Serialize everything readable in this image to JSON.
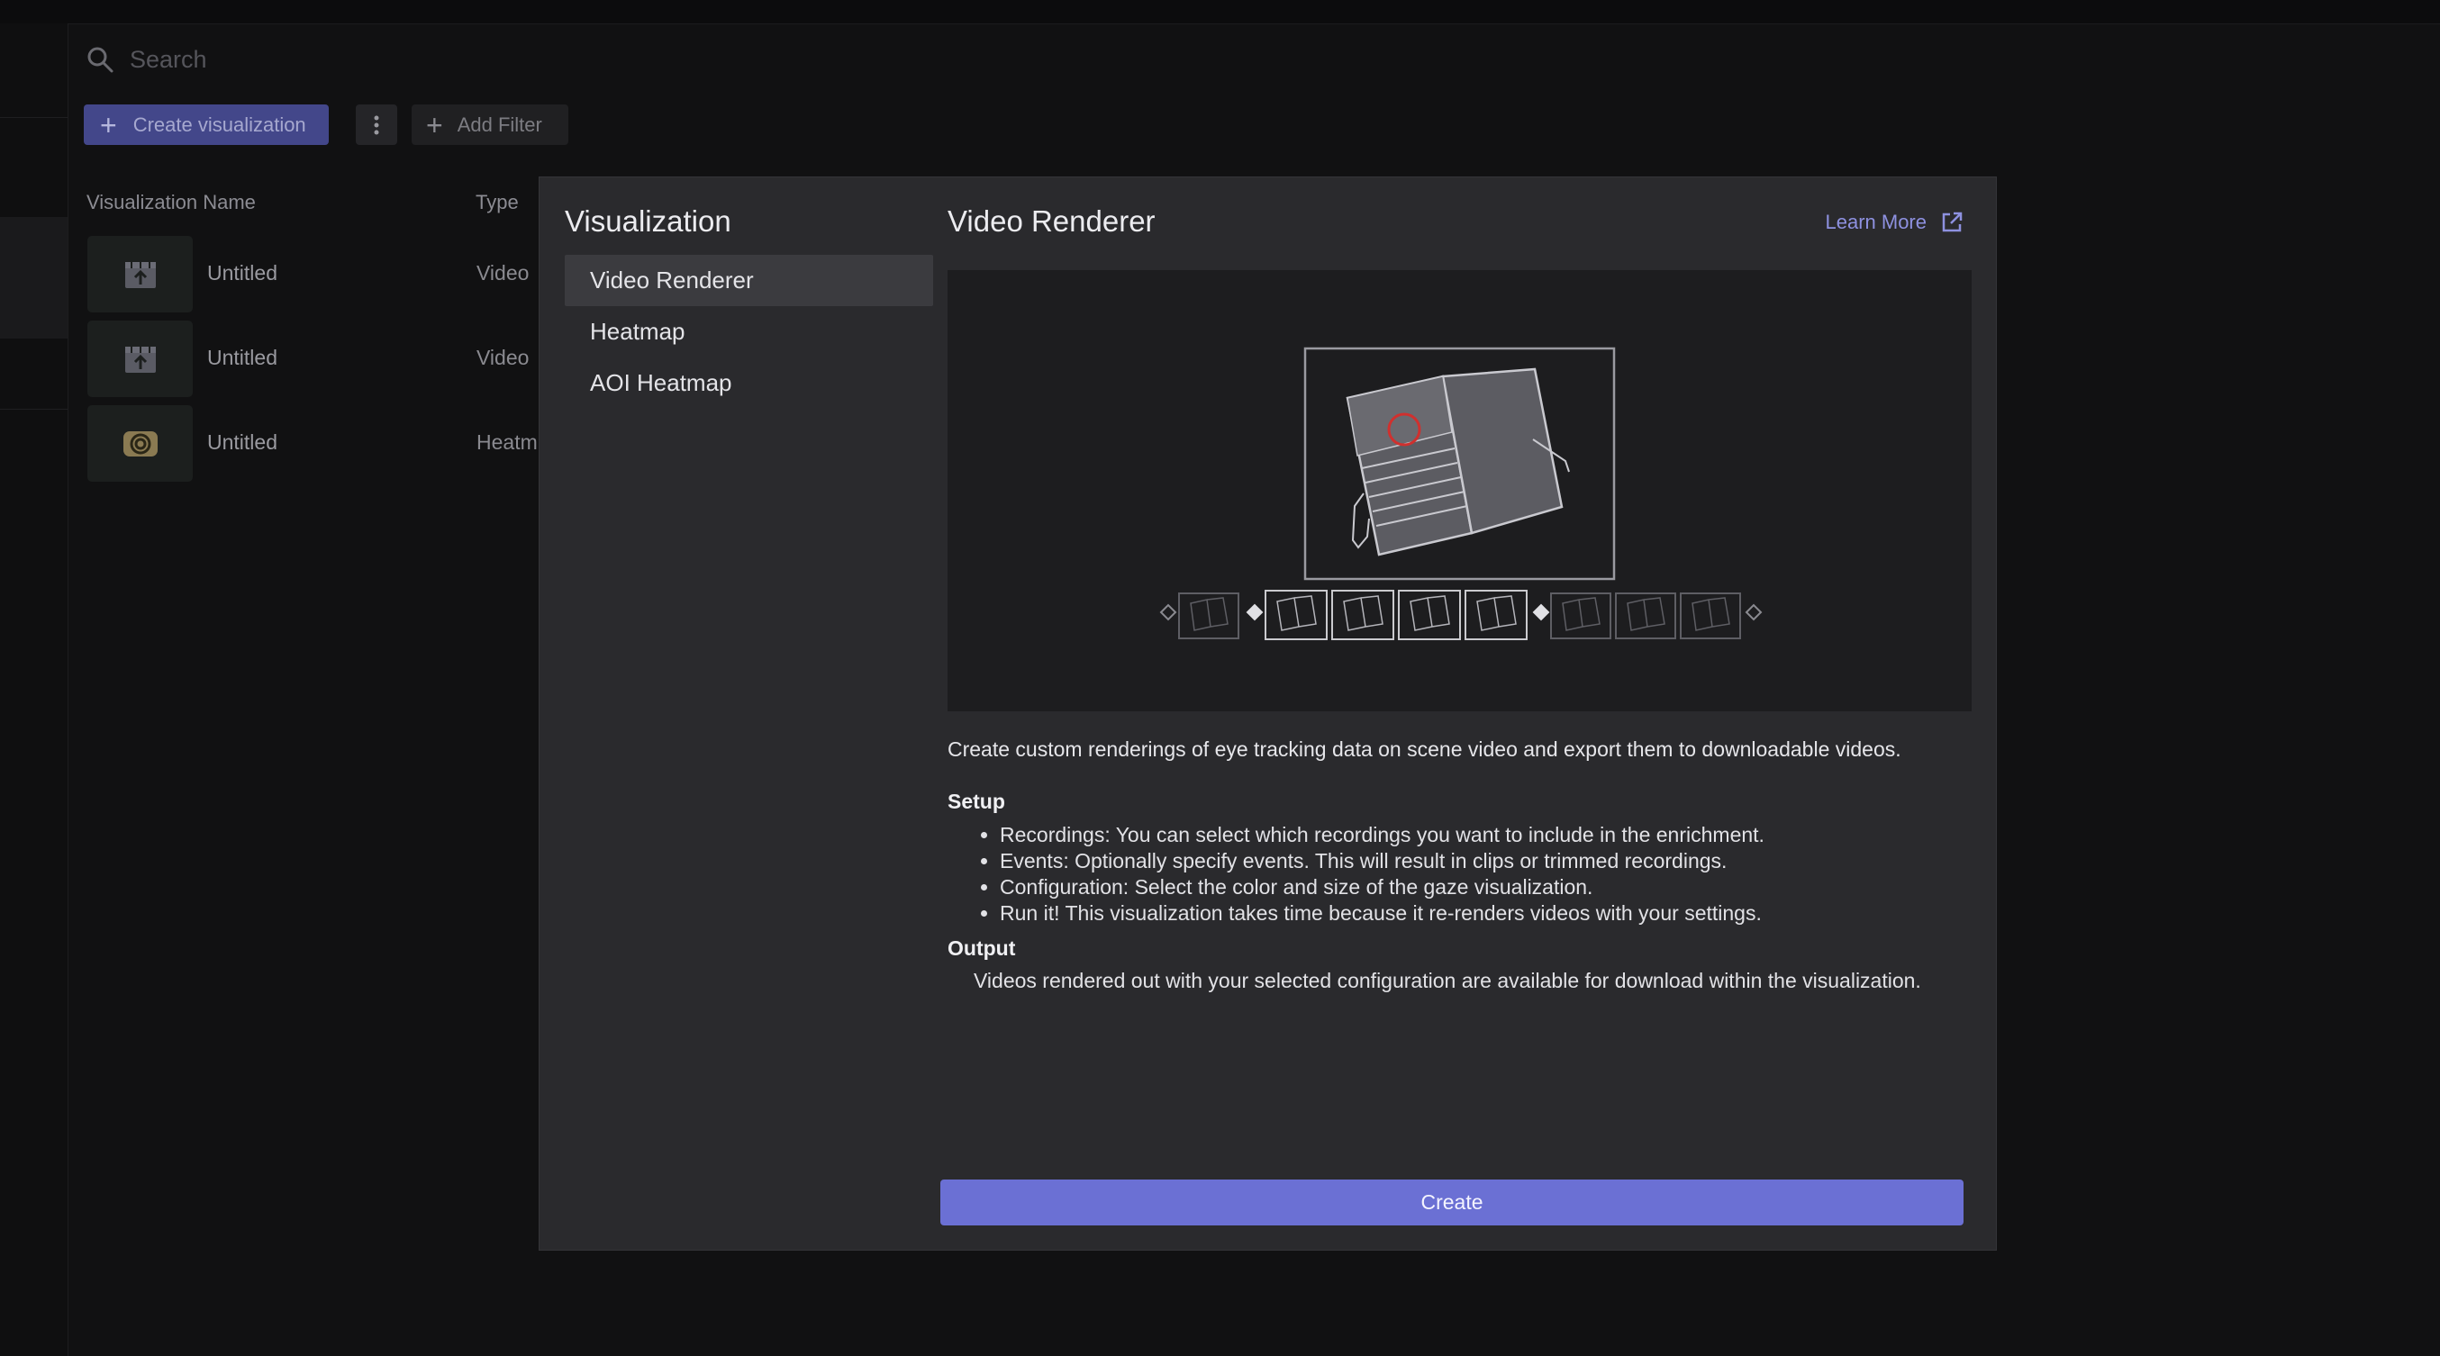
{
  "search": {
    "placeholder": "Search"
  },
  "toolbar": {
    "create_label": "Create visualization",
    "filter_label": "Add Filter"
  },
  "table": {
    "columns": [
      "Visualization Name",
      "Type"
    ],
    "rows": [
      {
        "name": "Untitled",
        "type": "Video",
        "icon": "video-upload-icon"
      },
      {
        "name": "Untitled",
        "type": "Video",
        "icon": "video-upload-icon"
      },
      {
        "name": "Untitled",
        "type": "Heatm",
        "icon": "heatmap-icon"
      }
    ]
  },
  "modal": {
    "title": "Visualization",
    "menu": [
      "Video Renderer",
      "Heatmap",
      "AOI Heatmap"
    ],
    "selected": "Video Renderer",
    "detail": {
      "title": "Video Renderer",
      "learn_more": "Learn More",
      "description": "Create custom renderings of eye tracking data on scene video and export them to downloadable videos.",
      "setup_heading": "Setup",
      "setup_items": [
        "Recordings: You can select which recordings you want to include in the enrichment.",
        "Events: Optionally specify events. This will result in clips or trimmed recordings.",
        "Configuration: Select the color and size of the gaze visualization.",
        "Run it! This visualization takes time because it re-renders videos with your settings."
      ],
      "output_heading": "Output",
      "output_text": "Videos rendered out with your selected configuration are available for download within the visualization."
    },
    "create_label": "Create"
  },
  "colors": {
    "accent": "#6b70d4",
    "accent_dim": "#43478a",
    "link": "#8e91e0",
    "gaze_circle": "#d0302e",
    "modal_bg": "#2a2a2d",
    "page_bg": "#121213"
  }
}
